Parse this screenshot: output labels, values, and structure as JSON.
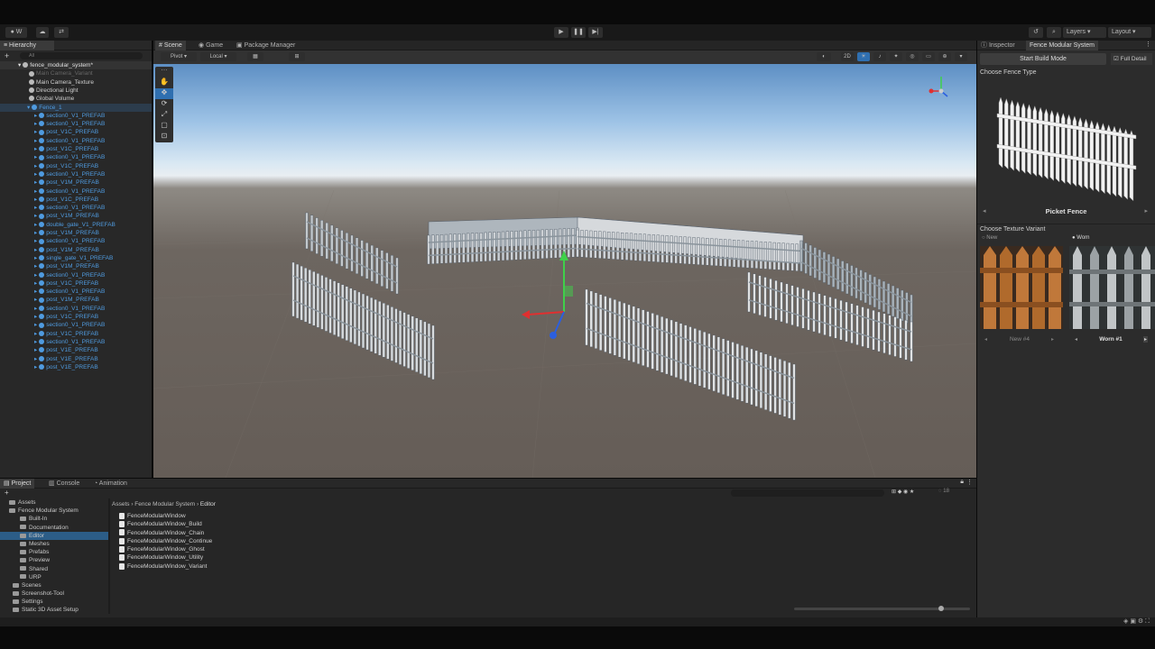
{
  "toolbar": {
    "account_label": "W",
    "layers_label": "Layers",
    "layout_label": "Layout"
  },
  "hierarchy": {
    "tab_label": "Hierarchy",
    "search_placeholder": "All",
    "scene_name": "fence_modular_system*",
    "items": [
      "Main Camera_Variant",
      "Main Camera_Texture",
      "Directional Light",
      "Global Volume",
      "Fence_1"
    ],
    "children": [
      "section0_V1_PREFAB",
      "section0_V1_PREFAB",
      "post_V1C_PREFAB",
      "section0_V1_PREFAB",
      "post_V1C_PREFAB",
      "section0_V1_PREFAB",
      "post_V1C_PREFAB",
      "section0_V1_PREFAB",
      "post_V1M_PREFAB",
      "section0_V1_PREFAB",
      "post_V1C_PREFAB",
      "section0_V1_PREFAB",
      "post_V1M_PREFAB",
      "double_gate_V1_PREFAB",
      "post_V1M_PREFAB",
      "section0_V1_PREFAB",
      "post_V1M_PREFAB",
      "single_gate_V1_PREFAB",
      "post_V1M_PREFAB",
      "section0_V1_PREFAB",
      "post_V1C_PREFAB",
      "section0_V1_PREFAB",
      "post_V1M_PREFAB",
      "section0_V1_PREFAB",
      "post_V1C_PREFAB",
      "section0_V1_PREFAB",
      "post_V1C_PREFAB",
      "section0_V1_PREFAB",
      "post_V1E_PREFAB",
      "post_V1E_PREFAB",
      "post_V1E_PREFAB"
    ]
  },
  "scene_view": {
    "tabs": [
      "Scene",
      "Game",
      "Package Manager"
    ],
    "pivot_label": "Pivot",
    "local_label": "Local",
    "two_d_label": "2D"
  },
  "inspector": {
    "tabs": [
      "Inspector",
      "Fence Modular System"
    ],
    "build_mode_button": "Start Build Mode",
    "full_detail_label": "Full Detail",
    "choose_type_label": "Choose Fence Type",
    "fence_type_name": "Picket Fence",
    "choose_texture_label": "Choose Texture Variant",
    "variant_options": [
      "New",
      "Worn"
    ],
    "variant_left_name": "New #4",
    "variant_right_name": "Worn #1"
  },
  "project": {
    "tabs": [
      "Project",
      "Console",
      "Animation"
    ],
    "tree": [
      "Assets",
      "Fence Modular System",
      "Built-In",
      "Documentation",
      "Editor",
      "Meshes",
      "Prefabs",
      "Preview",
      "Shared",
      "URP",
      "Scenes",
      "Screenshot-Tool",
      "Settings",
      "Static 3D Asset Setup"
    ],
    "breadcrumb": [
      "Assets",
      "Fence Modular System",
      "Editor"
    ],
    "files": [
      "FenceModularWindow",
      "FenceModularWindow_Build",
      "FenceModularWindow_Chain",
      "FenceModularWindow_Continue",
      "FenceModularWindow_Ghost",
      "FenceModularWindow_Utility",
      "FenceModularWindow_Variant"
    ],
    "hidden_count": "18"
  },
  "colors": {
    "accent": "#2f6fb0",
    "prefab_text": "#4f9be0",
    "selected_row": "#2c5d87"
  }
}
